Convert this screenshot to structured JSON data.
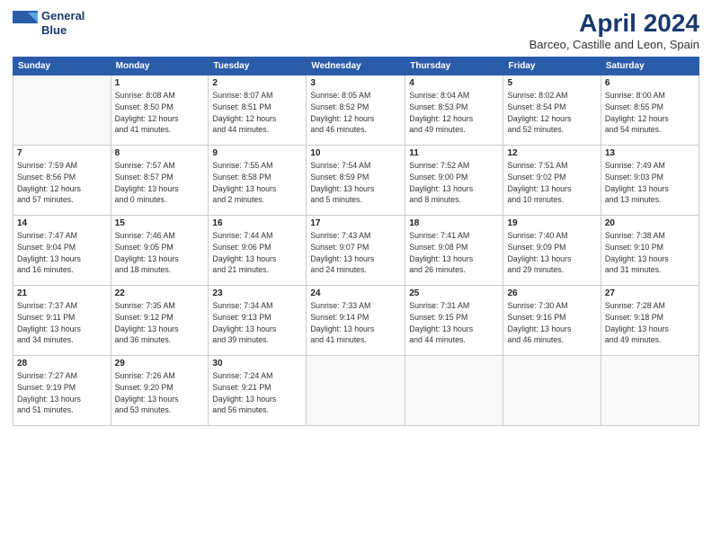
{
  "header": {
    "logo_line1": "General",
    "logo_line2": "Blue",
    "title": "April 2024",
    "location": "Barceo, Castille and Leon, Spain"
  },
  "weekdays": [
    "Sunday",
    "Monday",
    "Tuesday",
    "Wednesday",
    "Thursday",
    "Friday",
    "Saturday"
  ],
  "weeks": [
    [
      {
        "day": "",
        "info": ""
      },
      {
        "day": "1",
        "info": "Sunrise: 8:08 AM\nSunset: 8:50 PM\nDaylight: 12 hours\nand 41 minutes."
      },
      {
        "day": "2",
        "info": "Sunrise: 8:07 AM\nSunset: 8:51 PM\nDaylight: 12 hours\nand 44 minutes."
      },
      {
        "day": "3",
        "info": "Sunrise: 8:05 AM\nSunset: 8:52 PM\nDaylight: 12 hours\nand 46 minutes."
      },
      {
        "day": "4",
        "info": "Sunrise: 8:04 AM\nSunset: 8:53 PM\nDaylight: 12 hours\nand 49 minutes."
      },
      {
        "day": "5",
        "info": "Sunrise: 8:02 AM\nSunset: 8:54 PM\nDaylight: 12 hours\nand 52 minutes."
      },
      {
        "day": "6",
        "info": "Sunrise: 8:00 AM\nSunset: 8:55 PM\nDaylight: 12 hours\nand 54 minutes."
      }
    ],
    [
      {
        "day": "7",
        "info": "Sunrise: 7:59 AM\nSunset: 8:56 PM\nDaylight: 12 hours\nand 57 minutes."
      },
      {
        "day": "8",
        "info": "Sunrise: 7:57 AM\nSunset: 8:57 PM\nDaylight: 13 hours\nand 0 minutes."
      },
      {
        "day": "9",
        "info": "Sunrise: 7:55 AM\nSunset: 8:58 PM\nDaylight: 13 hours\nand 2 minutes."
      },
      {
        "day": "10",
        "info": "Sunrise: 7:54 AM\nSunset: 8:59 PM\nDaylight: 13 hours\nand 5 minutes."
      },
      {
        "day": "11",
        "info": "Sunrise: 7:52 AM\nSunset: 9:00 PM\nDaylight: 13 hours\nand 8 minutes."
      },
      {
        "day": "12",
        "info": "Sunrise: 7:51 AM\nSunset: 9:02 PM\nDaylight: 13 hours\nand 10 minutes."
      },
      {
        "day": "13",
        "info": "Sunrise: 7:49 AM\nSunset: 9:03 PM\nDaylight: 13 hours\nand 13 minutes."
      }
    ],
    [
      {
        "day": "14",
        "info": "Sunrise: 7:47 AM\nSunset: 9:04 PM\nDaylight: 13 hours\nand 16 minutes."
      },
      {
        "day": "15",
        "info": "Sunrise: 7:46 AM\nSunset: 9:05 PM\nDaylight: 13 hours\nand 18 minutes."
      },
      {
        "day": "16",
        "info": "Sunrise: 7:44 AM\nSunset: 9:06 PM\nDaylight: 13 hours\nand 21 minutes."
      },
      {
        "day": "17",
        "info": "Sunrise: 7:43 AM\nSunset: 9:07 PM\nDaylight: 13 hours\nand 24 minutes."
      },
      {
        "day": "18",
        "info": "Sunrise: 7:41 AM\nSunset: 9:08 PM\nDaylight: 13 hours\nand 26 minutes."
      },
      {
        "day": "19",
        "info": "Sunrise: 7:40 AM\nSunset: 9:09 PM\nDaylight: 13 hours\nand 29 minutes."
      },
      {
        "day": "20",
        "info": "Sunrise: 7:38 AM\nSunset: 9:10 PM\nDaylight: 13 hours\nand 31 minutes."
      }
    ],
    [
      {
        "day": "21",
        "info": "Sunrise: 7:37 AM\nSunset: 9:11 PM\nDaylight: 13 hours\nand 34 minutes."
      },
      {
        "day": "22",
        "info": "Sunrise: 7:35 AM\nSunset: 9:12 PM\nDaylight: 13 hours\nand 36 minutes."
      },
      {
        "day": "23",
        "info": "Sunrise: 7:34 AM\nSunset: 9:13 PM\nDaylight: 13 hours\nand 39 minutes."
      },
      {
        "day": "24",
        "info": "Sunrise: 7:33 AM\nSunset: 9:14 PM\nDaylight: 13 hours\nand 41 minutes."
      },
      {
        "day": "25",
        "info": "Sunrise: 7:31 AM\nSunset: 9:15 PM\nDaylight: 13 hours\nand 44 minutes."
      },
      {
        "day": "26",
        "info": "Sunrise: 7:30 AM\nSunset: 9:16 PM\nDaylight: 13 hours\nand 46 minutes."
      },
      {
        "day": "27",
        "info": "Sunrise: 7:28 AM\nSunset: 9:18 PM\nDaylight: 13 hours\nand 49 minutes."
      }
    ],
    [
      {
        "day": "28",
        "info": "Sunrise: 7:27 AM\nSunset: 9:19 PM\nDaylight: 13 hours\nand 51 minutes."
      },
      {
        "day": "29",
        "info": "Sunrise: 7:26 AM\nSunset: 9:20 PM\nDaylight: 13 hours\nand 53 minutes."
      },
      {
        "day": "30",
        "info": "Sunrise: 7:24 AM\nSunset: 9:21 PM\nDaylight: 13 hours\nand 56 minutes."
      },
      {
        "day": "",
        "info": ""
      },
      {
        "day": "",
        "info": ""
      },
      {
        "day": "",
        "info": ""
      },
      {
        "day": "",
        "info": ""
      }
    ]
  ]
}
